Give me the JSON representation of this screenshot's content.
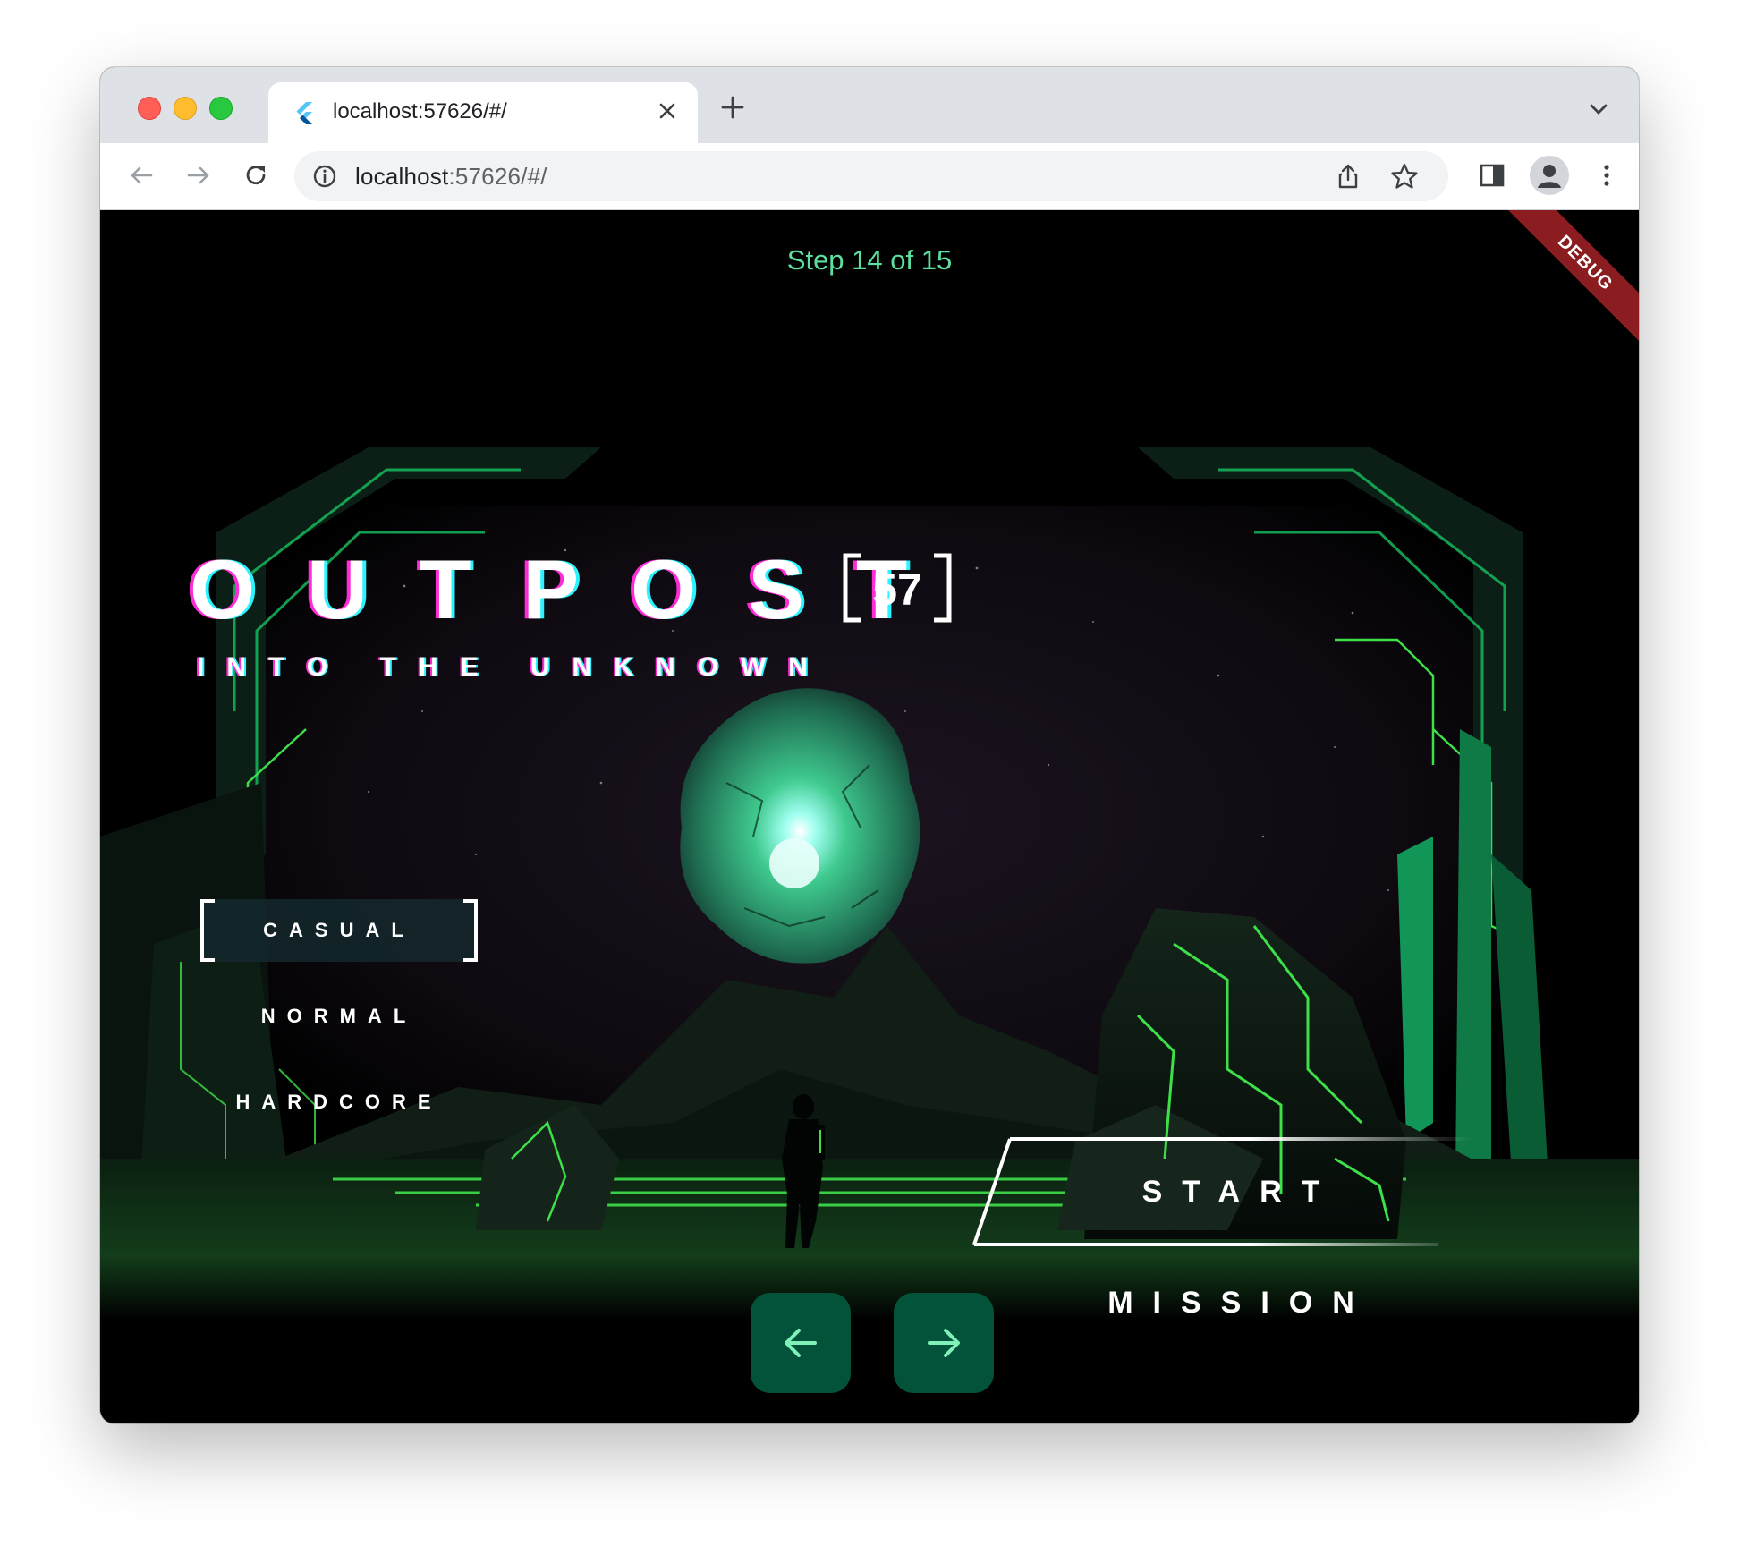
{
  "browser": {
    "tab_title": "localhost:57626/#/",
    "url_host": "localhost",
    "url_path": ":57626/#/"
  },
  "page": {
    "step_text": "Step 14 of 15",
    "debug_label": "DEBUG",
    "title": "OUTPOST",
    "title_badge": "57",
    "subtitle": "INTO THE UNKNOWN",
    "difficulties": [
      "CASUAL",
      "NORMAL",
      "HARDCORE"
    ],
    "selected_difficulty": "CASUAL",
    "start_label": "START MISSION",
    "prev_icon": "arrow-left-icon",
    "next_icon": "arrow-right-icon"
  },
  "colors": {
    "accent": "#5ce0a0",
    "nav_button": "#03533a",
    "circuit_green": "#3ee04a",
    "orb": "#3fc98e"
  }
}
